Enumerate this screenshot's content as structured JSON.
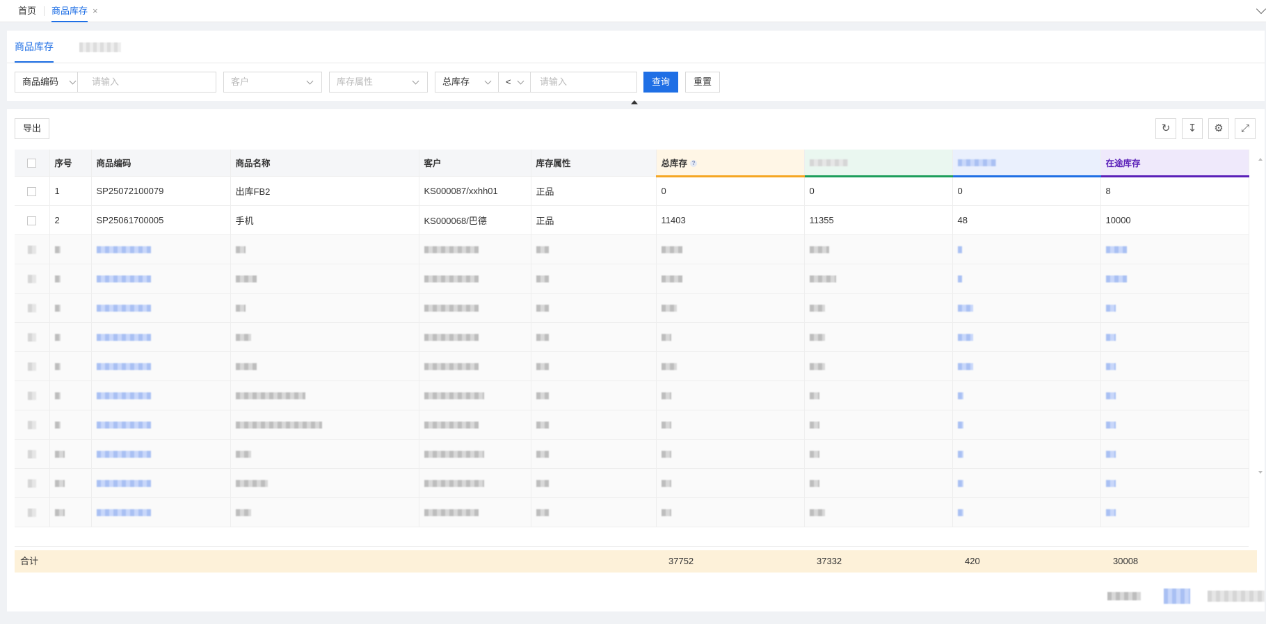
{
  "topbar": {
    "tabs": [
      {
        "label": "首页"
      },
      {
        "label": "商品库存"
      }
    ],
    "close_glyph": "×",
    "expand_icon": "chevron-down-icon"
  },
  "subtabs": [
    {
      "label": "商品库存"
    }
  ],
  "filters": {
    "code_select": "商品编码",
    "code_placeholder": "请输入",
    "customer_placeholder": "客户",
    "attr_placeholder": "库存属性",
    "stock_select": "总库存",
    "op_select": "<",
    "stock_placeholder": "请输入",
    "query_button": "查询",
    "reset_button": "重置"
  },
  "toolbar": {
    "export_button": "导出",
    "icons": [
      "refresh-icon",
      "column-height-icon",
      "settings-icon",
      "fullscreen-icon"
    ]
  },
  "table": {
    "headers": {
      "index": "序号",
      "code": "商品编码",
      "name": "商品名称",
      "customer": "客户",
      "attr": "库存属性",
      "total": "总库存",
      "in_transit": "在途库存"
    },
    "help_glyph": "?",
    "rows": [
      {
        "index": "1",
        "code": "SP25072100079",
        "name": "出库FB2",
        "customer": "KS000087/xxhh01",
        "attr": "正品",
        "total": "0",
        "c2": "0",
        "c3": "0",
        "in_transit": "8"
      },
      {
        "index": "2",
        "code": "SP25061700005",
        "name": "手机",
        "customer": "KS000068/巴德",
        "attr": "正品",
        "total": "11403",
        "c2": "11355",
        "c3": "48",
        "in_transit": "10000"
      }
    ],
    "footer": {
      "label": "合计",
      "total": "37752",
      "c2": "37332",
      "c3": "420",
      "in_transit": "30008"
    }
  },
  "colors": {
    "primary": "#1f6fe5",
    "total_accent": "#f5a623",
    "col2_accent": "#1d9e5c",
    "col3_accent": "#1f6fe5",
    "in_transit_accent": "#5a20b8",
    "footer_bg": "#fdf1d9"
  }
}
